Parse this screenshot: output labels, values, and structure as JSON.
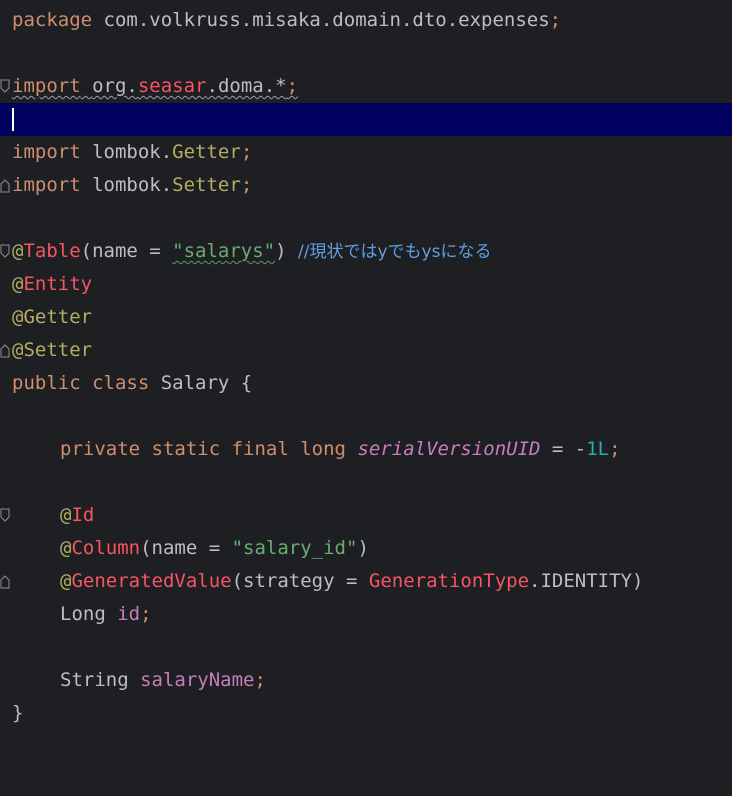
{
  "editor": {
    "package_kw": "package",
    "package_name": "com.volkruss.misaka.domain.dto.expenses",
    "import_kw": "import",
    "import1_a": "org.",
    "import1_b": "seasar",
    "import1_c": ".doma.*",
    "import2_pkg": "lombok.",
    "import2_cls": "Getter",
    "import3_pkg": "lombok.",
    "import3_cls": "Setter",
    "semi": ";",
    "table_at": "@",
    "table_name": "Table",
    "table_arg_open": "(name = ",
    "table_arg_val": "\"salarys\"",
    "table_arg_close": ") ",
    "table_comment_1": "//現状では",
    "table_comment_2": "y",
    "table_comment_3": "でも",
    "table_comment_4": "ys",
    "table_comment_5": "になる",
    "entity_at": "@",
    "entity_name": "Entity",
    "getter_ann": "@Getter",
    "setter_ann": "@Setter",
    "class_kw1": "public",
    "class_kw2": "class",
    "class_name": " Salary {",
    "field_mods": "private static final long",
    "field_name": "serialVersionUID",
    "field_eq": " = -",
    "field_val": "1L",
    "id_at": "@",
    "id_name": "Id",
    "column_at": "@",
    "column_name": "Column",
    "column_arg_open": "(name = ",
    "column_arg_val": "\"salary_id\"",
    "column_arg_close": ")",
    "gen_at": "@",
    "gen_name": "GeneratedValue",
    "gen_arg_open": "(strategy = ",
    "gen_type": "GenerationType",
    "gen_const": ".IDENTITY)",
    "id_type": "Long ",
    "id_field": "id",
    "name_type": "String ",
    "name_field": "salaryName",
    "close_brace": "}"
  }
}
